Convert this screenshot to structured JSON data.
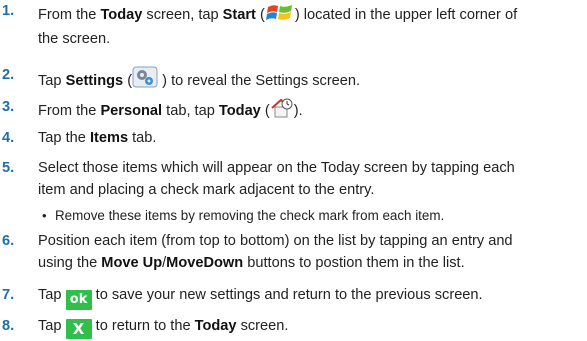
{
  "steps": [
    {
      "number": "1.",
      "line1": {
        "a": "From the ",
        "b1": "Today",
        "c": " screen, tap ",
        "b2": "Start",
        "d": " (",
        "e": ") located in the upper left corner of"
      },
      "line2": "the screen.",
      "icon": "windows-start-flag-icon"
    },
    {
      "number": "2.",
      "line1": {
        "a": "Tap ",
        "b1": "Settings",
        "c": " (",
        "d": " ) to reveal the Settings screen."
      },
      "icon": "settings-gears-icon"
    },
    {
      "number": "3.",
      "line1": {
        "a": "From the ",
        "b1": "Personal",
        "c": " tab, tap ",
        "b2": "Today",
        "d": " (",
        "e": ")."
      },
      "icon": "today-house-clock-icon"
    },
    {
      "number": "4.",
      "line1": {
        "a": "Tap the ",
        "b1": "Items",
        "c": " tab."
      }
    },
    {
      "number": "5.",
      "line1": "Select those items which will appear on the Today screen by tapping each",
      "line2": "item and placing a check mark adjacent to the entry.",
      "bullet": "Remove these items by removing the check mark from each item."
    },
    {
      "number": "6.",
      "line1": "Position each item (from top to bottom) on the list by tapping an entry and",
      "line2": {
        "a": "using the ",
        "b1": "Move Up",
        "c": "/",
        "b2": "MoveDown",
        "d": " buttons to postion them in the list."
      }
    },
    {
      "number": "7.",
      "line1": {
        "a": "Tap ",
        "c": " to save your new settings and return to the previous screen."
      },
      "button": "ok"
    },
    {
      "number": "8.",
      "line1": {
        "a": "Tap ",
        "c": " to return to the ",
        "b1": "Today",
        "d": " screen."
      },
      "button": "X"
    }
  ],
  "colors": {
    "step_number": "#1c6fa8",
    "button_green": "#2fbf4a",
    "text": "#222222"
  }
}
